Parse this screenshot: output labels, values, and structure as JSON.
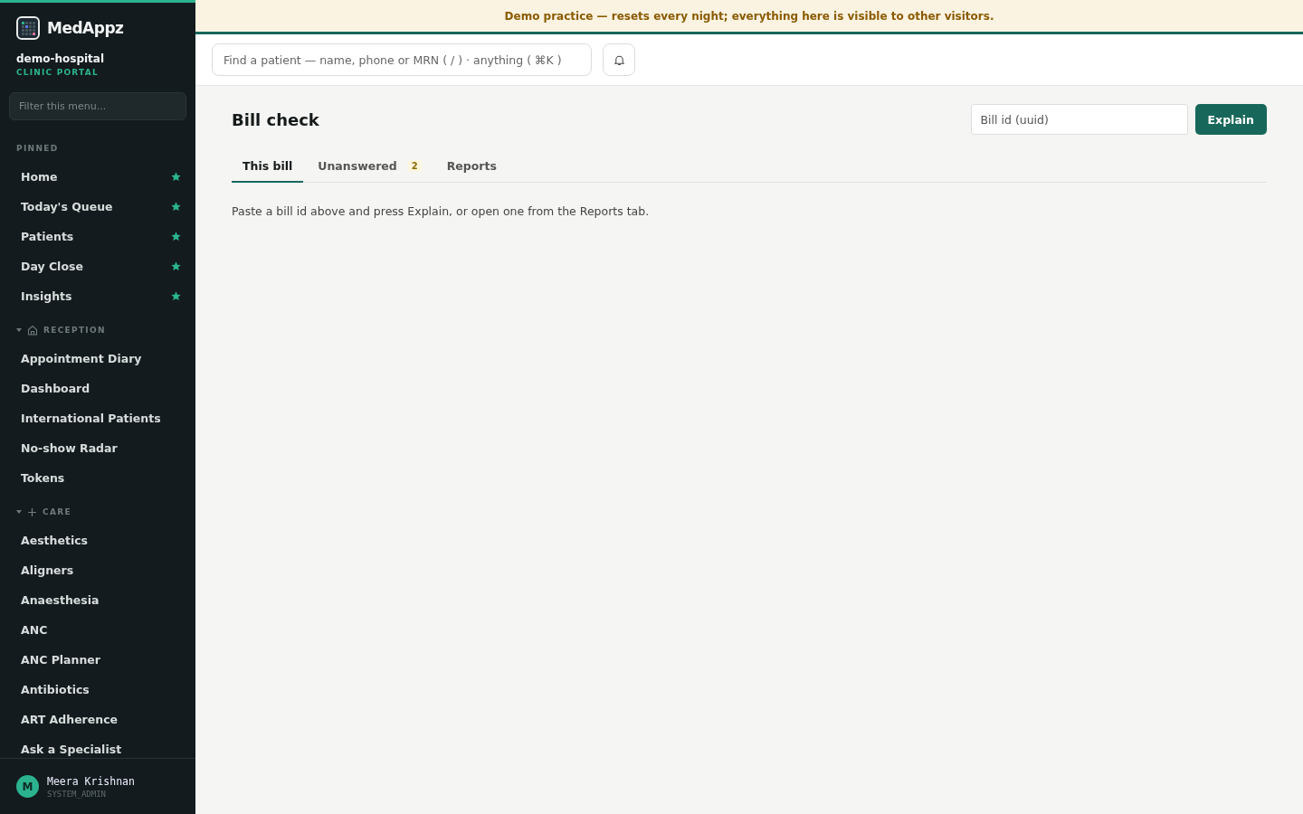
{
  "banner": "Demo practice — resets every night; everything here is visible to other visitors.",
  "sidebar": {
    "brand": "MedAppz",
    "org": "demo-hospital",
    "portal": "CLINIC PORTAL",
    "filter": {
      "placeholder": "Filter this menu..."
    },
    "sections": [
      {
        "kind": "pinned",
        "title": "PINNED",
        "items": [
          {
            "label": "Home",
            "starred": true
          },
          {
            "label": "Today's Queue",
            "starred": true
          },
          {
            "label": "Patients",
            "starred": true
          },
          {
            "label": "Day Close",
            "starred": true
          },
          {
            "label": "Insights",
            "starred": true
          }
        ]
      },
      {
        "kind": "group",
        "title": "RECEPTION",
        "expanded": true,
        "items": [
          {
            "label": "Appointment Diary",
            "starred": false
          },
          {
            "label": "Dashboard",
            "starred": false
          },
          {
            "label": "International Patients",
            "starred": false
          },
          {
            "label": "No-show Radar",
            "starred": false
          },
          {
            "label": "Tokens",
            "starred": false
          }
        ]
      },
      {
        "kind": "group",
        "title": "CARE",
        "expanded": true,
        "items": [
          {
            "label": "Aesthetics",
            "starred": false
          },
          {
            "label": "Aligners",
            "starred": false
          },
          {
            "label": "Anaesthesia",
            "starred": false
          },
          {
            "label": "ANC",
            "starred": false
          },
          {
            "label": "ANC Planner",
            "starred": false
          },
          {
            "label": "Antibiotics",
            "starred": false
          },
          {
            "label": "ART Adherence",
            "starred": false
          },
          {
            "label": "Ask a Specialist",
            "starred": false
          }
        ]
      }
    ],
    "user": {
      "initial": "M",
      "name": "Meera Krishnan",
      "role": "SYSTEM_ADMIN"
    }
  },
  "topbar": {
    "search": {
      "placeholder": "Find a patient — name, phone or MRN ( / ) · anything ( ⌘K )"
    }
  },
  "page": {
    "title": "Bill check",
    "bill_field": {
      "placeholder": "Bill id (uuid)"
    },
    "action": "Explain",
    "tabs": [
      {
        "label": "This bill",
        "selected": true
      },
      {
        "label": "Unanswered",
        "badge": "2",
        "selected": false
      },
      {
        "label": "Reports",
        "selected": false
      }
    ],
    "message": "Paste a bill id above and press Explain, or open one from the Reports tab."
  }
}
